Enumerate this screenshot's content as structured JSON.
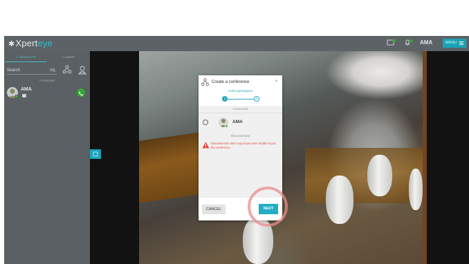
{
  "header": {
    "logo_prefix": "Xpert",
    "logo_suffix": "eye",
    "user_name": "AMA",
    "menu_label": "MENU"
  },
  "sidebar": {
    "tabs": [
      {
        "label": "CONTACTS",
        "active": true
      },
      {
        "label": "CHAT",
        "active": false
      }
    ],
    "search_value": "Search",
    "connected_label": "Connected",
    "contacts": [
      {
        "name": "AMA",
        "status": "online"
      }
    ]
  },
  "modal": {
    "title": "Create a conference",
    "close_glyph": "✕",
    "subtitle": "Invite participants",
    "steps": [
      "1",
      "2"
    ],
    "current_step": 1,
    "connected_label": "Connected",
    "participants": [
      {
        "name": "AMA",
        "status": "online"
      }
    ],
    "disconnected_label": "Disconnected",
    "warning": "Disconnected users may have some trouble to join the conference",
    "cancel_label": "CANCEL",
    "next_label": "NEXT"
  },
  "colors": {
    "accent": "#22aec5",
    "online": "#49b649",
    "warning": "#e04a3a",
    "highlight": "#e88c8c"
  }
}
